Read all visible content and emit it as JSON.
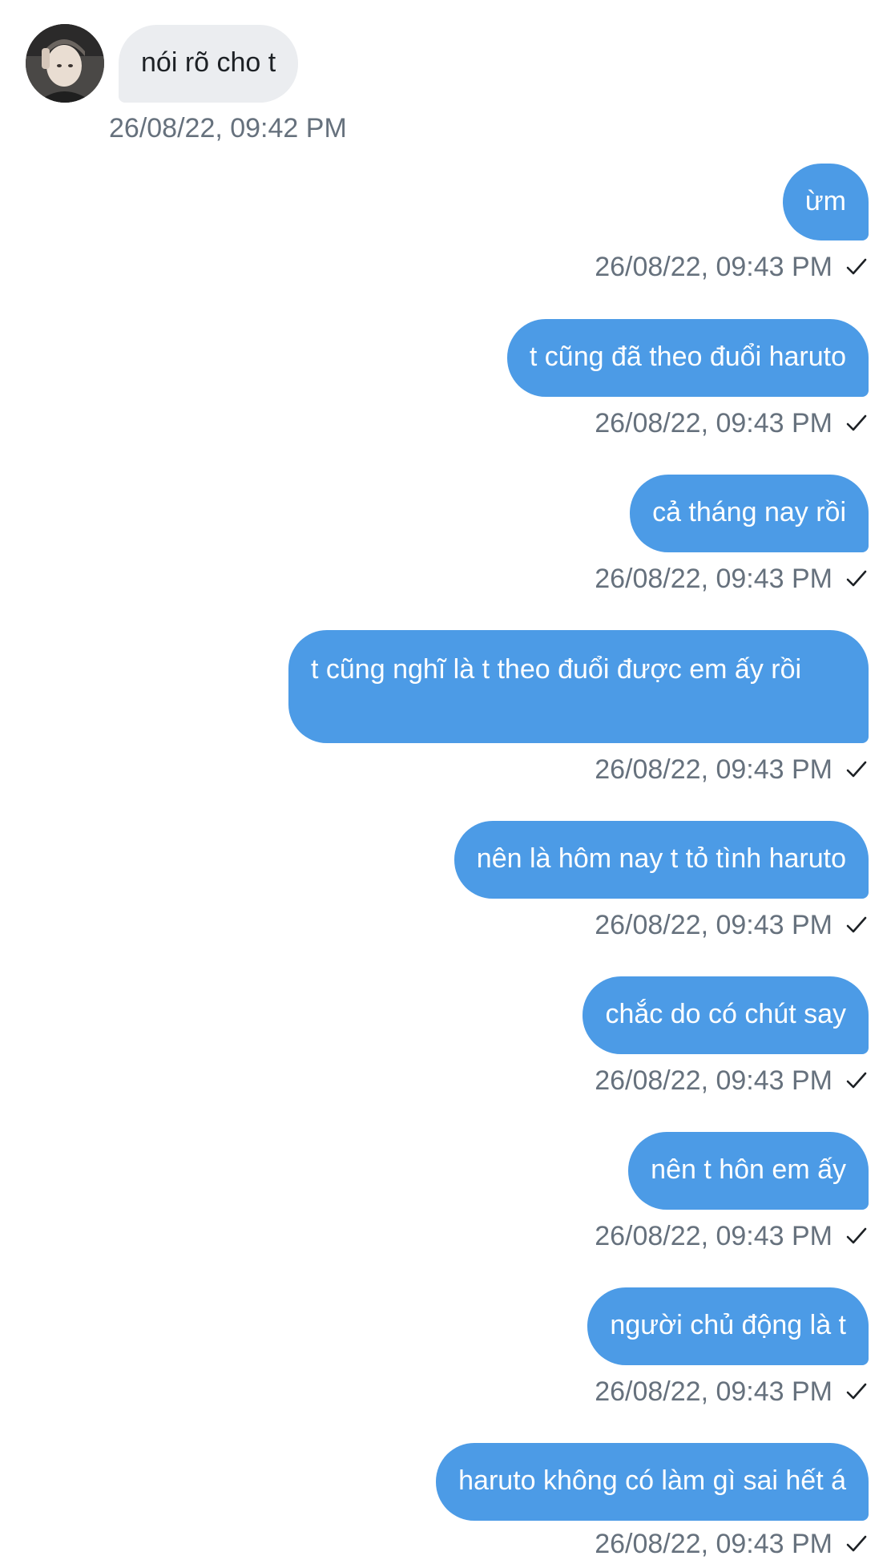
{
  "messages": [
    {
      "direction": "incoming",
      "text": "nói rõ cho t",
      "time": "26/08/22, 09:42 PM"
    },
    {
      "direction": "outgoing",
      "text": "ừm",
      "time": "26/08/22, 09:43 PM",
      "status": "sent-check-icon"
    },
    {
      "direction": "outgoing",
      "text": "t cũng đã theo đuổi haruto",
      "time": "26/08/22, 09:43 PM",
      "status": "sent-check-icon"
    },
    {
      "direction": "outgoing",
      "text": "cả tháng nay rồi",
      "time": "26/08/22, 09:43 PM",
      "status": "sent-check-icon"
    },
    {
      "direction": "outgoing",
      "text": "t cũng nghĩ là t theo đuổi được em ấy rồi",
      "time": "26/08/22, 09:43 PM",
      "status": "sent-check-icon"
    },
    {
      "direction": "outgoing",
      "text": "nên là hôm nay t tỏ tình haruto",
      "time": "26/08/22, 09:43 PM",
      "status": "sent-check-icon"
    },
    {
      "direction": "outgoing",
      "text": "chắc do có chút say",
      "time": "26/08/22, 09:43 PM",
      "status": "sent-check-icon"
    },
    {
      "direction": "outgoing",
      "text": "nên t hôn em ấy",
      "time": "26/08/22, 09:43 PM",
      "status": "sent-check-icon"
    },
    {
      "direction": "outgoing",
      "text": "người chủ động là t",
      "time": "26/08/22, 09:43 PM",
      "status": "sent-check-icon"
    },
    {
      "direction": "outgoing",
      "text": "haruto không có làm gì sai hết á",
      "time": "26/08/22, 09:43 PM",
      "status": "sent-check-icon"
    }
  ],
  "colors": {
    "outgoing_bubble": "#4c9be6",
    "incoming_bubble": "#ebedf0",
    "timestamp": "#66717d"
  },
  "icons": {
    "avatar": "contact-avatar",
    "status": "checkmark-icon"
  }
}
